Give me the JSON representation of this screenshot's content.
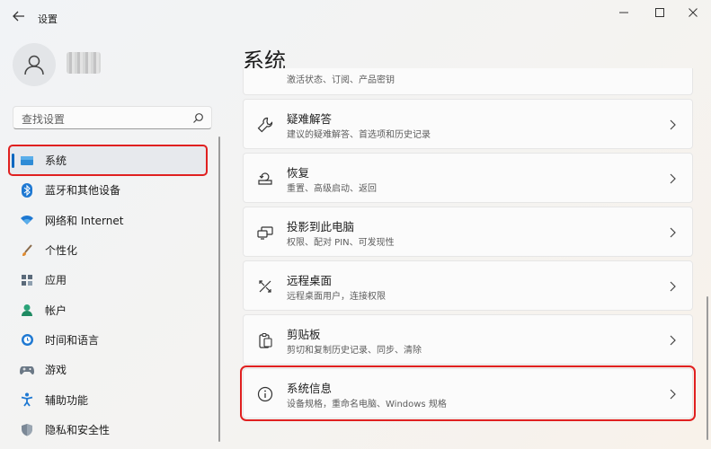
{
  "app": {
    "title": "设置"
  },
  "user": {
    "name": "用户"
  },
  "search": {
    "placeholder": "查找设置"
  },
  "sidebar": {
    "items": [
      {
        "label": "系统",
        "icon": "monitor-icon",
        "active": true
      },
      {
        "label": "蓝牙和其他设备",
        "icon": "bluetooth-icon"
      },
      {
        "label": "网络和 Internet",
        "icon": "wifi-icon"
      },
      {
        "label": "个性化",
        "icon": "brush-icon"
      },
      {
        "label": "应用",
        "icon": "apps-icon"
      },
      {
        "label": "帐户",
        "icon": "account-icon"
      },
      {
        "label": "时间和语言",
        "icon": "globe-clock-icon"
      },
      {
        "label": "游戏",
        "icon": "gamepad-icon"
      },
      {
        "label": "辅助功能",
        "icon": "accessibility-icon"
      },
      {
        "label": "隐私和安全性",
        "icon": "shield-icon"
      }
    ]
  },
  "main": {
    "title": "系统",
    "cards": [
      {
        "title": "",
        "subtitle": "激活状态、订阅、产品密钥",
        "icon": ""
      },
      {
        "title": "疑难解答",
        "subtitle": "建议的疑难解答、首选项和历史记录",
        "icon": "wrench-icon"
      },
      {
        "title": "恢复",
        "subtitle": "重置、高级启动、返回",
        "icon": "recovery-icon"
      },
      {
        "title": "投影到此电脑",
        "subtitle": "权限、配对 PIN、可发现性",
        "icon": "projector-icon"
      },
      {
        "title": "远程桌面",
        "subtitle": "远程桌面用户，连接权限",
        "icon": "remote-desktop-icon"
      },
      {
        "title": "剪贴板",
        "subtitle": "剪切和复制历史记录、同步、清除",
        "icon": "clipboard-icon"
      },
      {
        "title": "系统信息",
        "subtitle": "设备规格，重命名电脑、Windows 规格",
        "icon": "info-icon"
      }
    ]
  },
  "colors": {
    "accent": "#0067c0",
    "highlight": "#e02020"
  }
}
